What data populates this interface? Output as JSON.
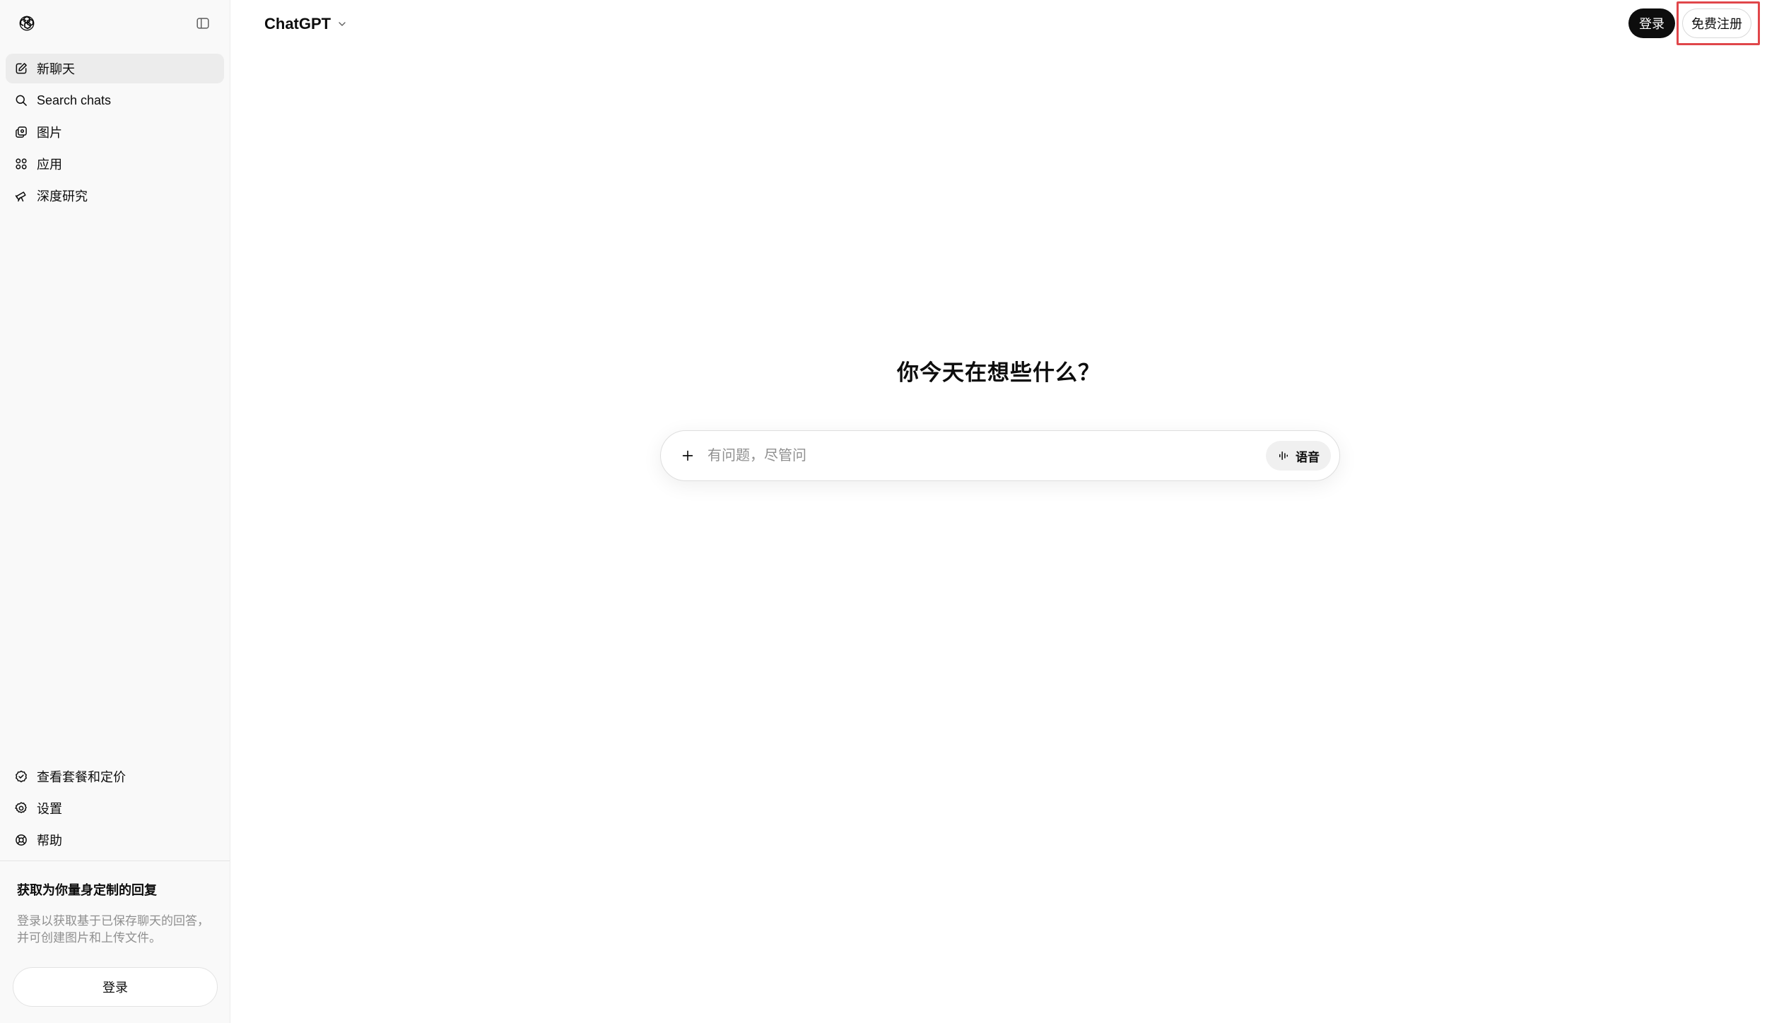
{
  "sidebar": {
    "top_icons": {
      "logo": "openai-logo-icon",
      "toggle": "sidebar-toggle-icon"
    },
    "nav": [
      {
        "label": "新聊天",
        "icon": "compose-icon"
      },
      {
        "label": "Search chats",
        "icon": "search-icon"
      },
      {
        "label": "图片",
        "icon": "images-icon"
      },
      {
        "label": "应用",
        "icon": "apps-grid-icon"
      },
      {
        "label": "深度研究",
        "icon": "telescope-icon"
      }
    ],
    "bottom_nav": [
      {
        "label": "查看套餐和定价",
        "icon": "plan-badge-icon"
      },
      {
        "label": "设置",
        "icon": "gear-icon"
      },
      {
        "label": "帮助",
        "icon": "lifebuoy-icon"
      }
    ],
    "promo": {
      "title": "获取为你量身定制的回复",
      "body": "登录以获取基于已保存聊天的回答，并可创建图片和上传文件。"
    },
    "login_label": "登录"
  },
  "header": {
    "model_name": "ChatGPT",
    "login_label": "登录",
    "signup_label": "免费注册"
  },
  "main": {
    "headline": "你今天在想些什么？",
    "composer": {
      "placeholder": "有问题，尽管问",
      "voice_label": "语音"
    }
  },
  "colors": {
    "sidebar_bg": "#f9f9f9",
    "active_item_bg": "#ececec",
    "primary_button": "#0d0d0d",
    "highlight": "#e0464a"
  }
}
